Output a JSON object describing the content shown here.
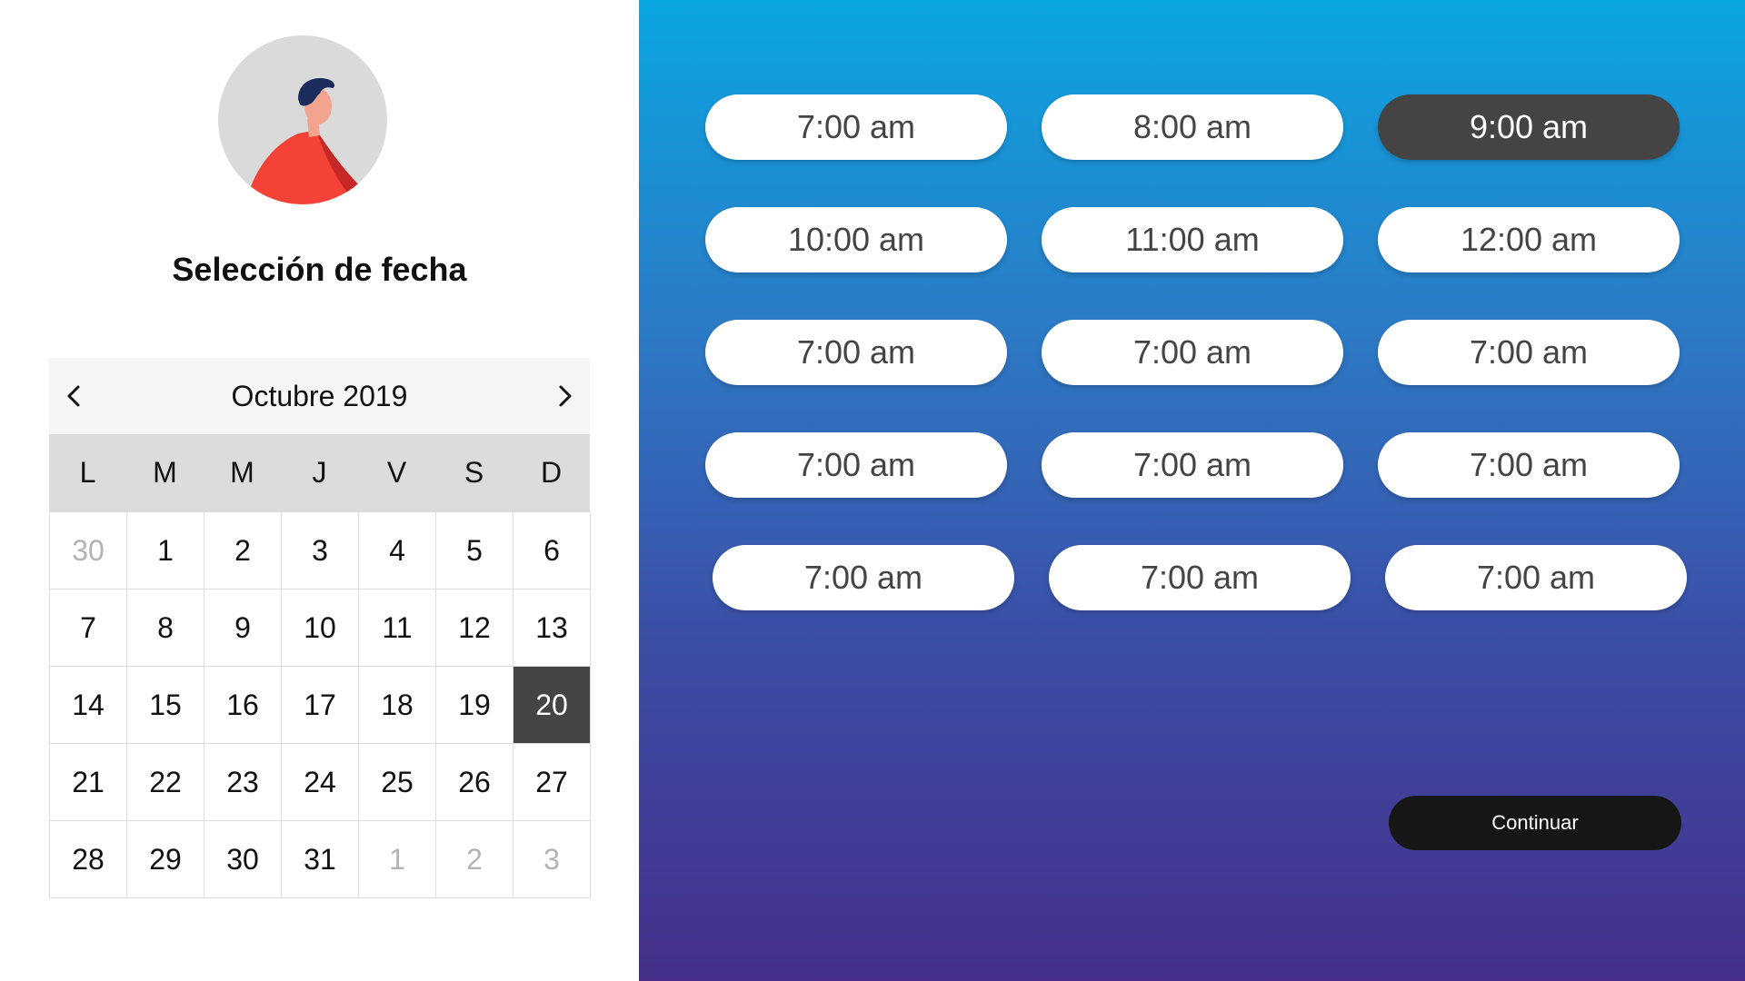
{
  "title": "Selección de fecha",
  "calendar": {
    "month_label": "Octubre 2019",
    "weekdays": [
      "L",
      "M",
      "M",
      "J",
      "V",
      "S",
      "D"
    ],
    "days": [
      {
        "label": "30",
        "muted": true
      },
      {
        "label": "1"
      },
      {
        "label": "2"
      },
      {
        "label": "3"
      },
      {
        "label": "4"
      },
      {
        "label": "5"
      },
      {
        "label": "6"
      },
      {
        "label": "7"
      },
      {
        "label": "8"
      },
      {
        "label": "9"
      },
      {
        "label": "10"
      },
      {
        "label": "11"
      },
      {
        "label": "12"
      },
      {
        "label": "13"
      },
      {
        "label": "14"
      },
      {
        "label": "15"
      },
      {
        "label": "16"
      },
      {
        "label": "17"
      },
      {
        "label": "18"
      },
      {
        "label": "19"
      },
      {
        "label": "20",
        "selected": true
      },
      {
        "label": "21"
      },
      {
        "label": "22"
      },
      {
        "label": "23"
      },
      {
        "label": "24"
      },
      {
        "label": "25"
      },
      {
        "label": "26"
      },
      {
        "label": "27"
      },
      {
        "label": "28"
      },
      {
        "label": "29"
      },
      {
        "label": "30"
      },
      {
        "label": "31"
      },
      {
        "label": "1",
        "muted": true
      },
      {
        "label": "2",
        "muted": true
      },
      {
        "label": "3",
        "muted": true
      }
    ],
    "prev_icon": "chevron-left-icon",
    "next_icon": "chevron-right-icon"
  },
  "time_slots": [
    {
      "label": "7:00 am"
    },
    {
      "label": "8:00 am"
    },
    {
      "label": "9:00 am",
      "selected": true
    },
    {
      "label": "10:00 am"
    },
    {
      "label": "11:00 am"
    },
    {
      "label": "12:00 am"
    },
    {
      "label": "7:00 am"
    },
    {
      "label": "7:00 am"
    },
    {
      "label": "7:00 am"
    },
    {
      "label": "7:00 am"
    },
    {
      "label": "7:00 am"
    },
    {
      "label": "7:00 am"
    },
    {
      "label": "7:00 am"
    },
    {
      "label": "7:00 am"
    },
    {
      "label": "7:00 am"
    }
  ],
  "continue_label": "Continuar",
  "colors": {
    "selected": "#444444",
    "gradient_top": "#0aa6e2",
    "gradient_bottom": "#452f8a",
    "avatar_shirt": "#f44336",
    "avatar_hair": "#1a2b5c"
  }
}
